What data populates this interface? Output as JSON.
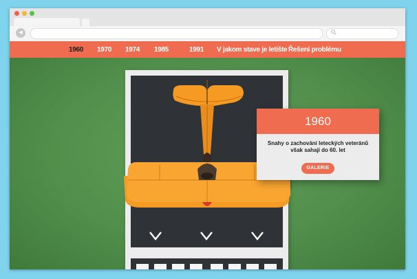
{
  "nav": {
    "items": [
      {
        "label": "1960",
        "active": true
      },
      {
        "label": "1970",
        "active": false
      },
      {
        "label": "1974",
        "active": false
      },
      {
        "label": "1985",
        "active": false
      },
      {
        "label": "1991",
        "active": false
      },
      {
        "label": "V jakom stave je letište",
        "active": false
      },
      {
        "label": "Řešení problému",
        "active": false
      }
    ]
  },
  "info_card": {
    "year": "1960",
    "text": "Snahy o zachování leteckých veteránů však sahají do 60. let",
    "button_label": "GALERIE"
  },
  "colors": {
    "accent": "#f06c50",
    "plane": "#f59a23",
    "grass": "#528f4c",
    "dark_panel": "#2f3338",
    "background": "#7fd3ec"
  },
  "icons": {
    "back": "arrow-left-icon",
    "search": "search-icon",
    "chevrons": "chevron-down-icon"
  }
}
